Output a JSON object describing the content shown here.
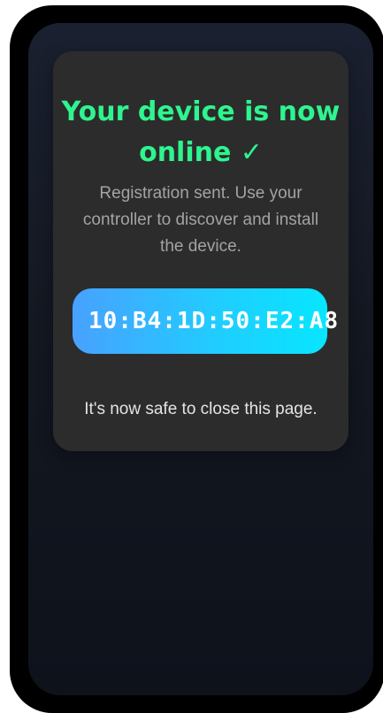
{
  "status_card": {
    "title": "Your device is now online ✓",
    "subtitle": "Registration sent. Use your controller to discover and install the device.",
    "mac_address": "10:B4:1D:50:E2:A8",
    "note": "It's now safe to close this page."
  },
  "colors": {
    "title": "#2ef58e",
    "pill_start": "#48a1ff",
    "pill_end": "#07e6ff",
    "card_bg": "#2c2c2c"
  }
}
